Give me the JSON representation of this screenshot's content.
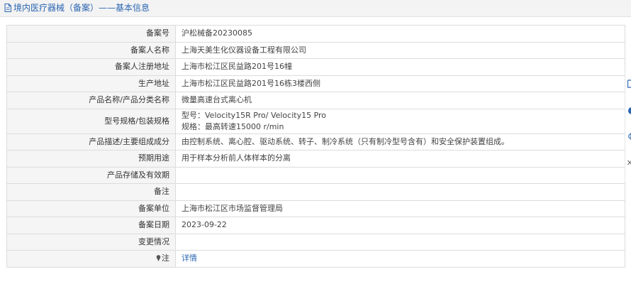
{
  "header": {
    "title": "境内医疗器械（备案）——基本信息"
  },
  "rows": [
    {
      "label": "备案号",
      "value": "沪松械备20230085"
    },
    {
      "label": "备案人名称",
      "value": "上海天美生化仪器设备工程有限公司"
    },
    {
      "label": "备案人注册地址",
      "value": "上海市松江区民益路201号16幢"
    },
    {
      "label": "生产地址",
      "value": "上海市松江区民益路201号16栋3楼西侧"
    },
    {
      "label": "产品名称/产品分类名称",
      "value": "微量高速台式离心机"
    },
    {
      "label": "型号规格/包装规格",
      "value_line1": "型号：Velocity15R Pro/ Velocity15 Pro",
      "value_line2": "规格：最高转速15000 r/min"
    },
    {
      "label": "产品描述/主要组成成分",
      "value": "由控制系统、离心腔、驱动系统、转子、制冷系统（只有制冷型号含有）和安全保护装置组成。"
    },
    {
      "label": "预期用途",
      "value": "用于样本分析前人体样本的分离"
    },
    {
      "label": "产品存储及有效期",
      "value": ""
    },
    {
      "label": "备注",
      "value": ""
    },
    {
      "label": "备案单位",
      "value": "上海市松江区市场监督管理局"
    },
    {
      "label": "备案日期",
      "value": "2023-09-22"
    },
    {
      "label": "变更情况",
      "value": ""
    },
    {
      "label": "注",
      "value": "详情"
    }
  ],
  "colors": {
    "accent": "#2b66b1",
    "label_bg": "#f5f5f5",
    "border": "#dcdcdc"
  }
}
